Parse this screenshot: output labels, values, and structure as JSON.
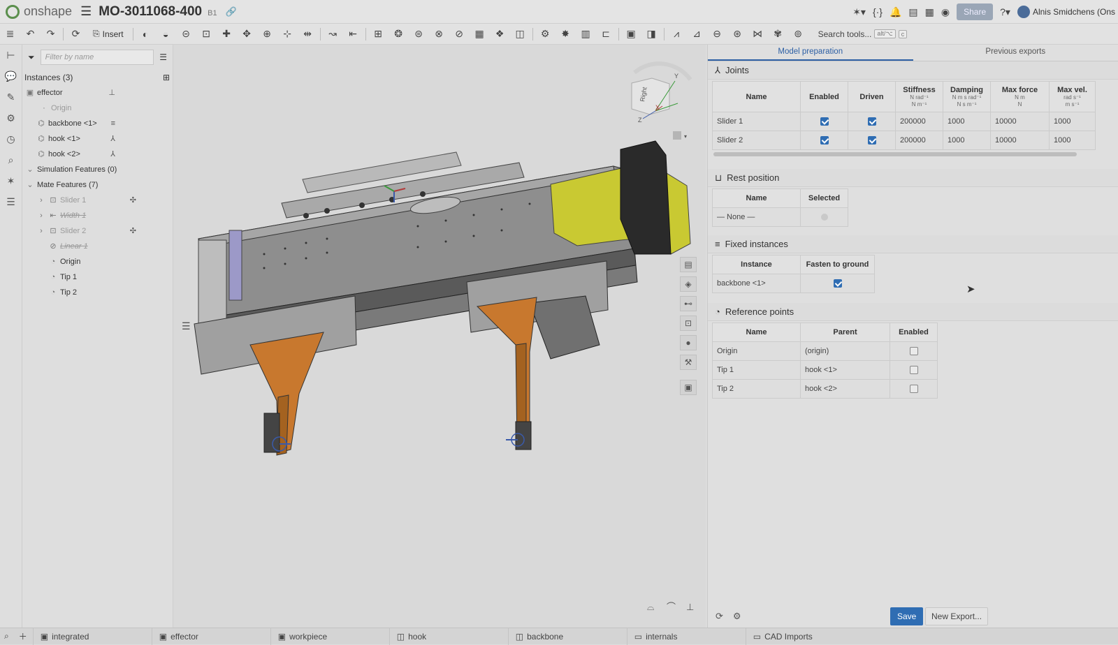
{
  "app": {
    "brand": "onshape",
    "doc_title": "MO-3011068-400",
    "doc_version": "B1"
  },
  "header": {
    "share_label": "Share",
    "user_name": "Alnis Smidchens (Ons"
  },
  "toolbar": {
    "insert_label": "Insert",
    "search_label": "Search tools...",
    "search_shortcut_1": "alt/⌥",
    "search_shortcut_2": "c"
  },
  "instances": {
    "filter_placeholder": "Filter by name",
    "header": "Instances (3)",
    "items": [
      {
        "label": "effector",
        "icon": "assembly-icon"
      },
      {
        "label": "Origin",
        "icon": "origin-icon"
      },
      {
        "label": "backbone <1>",
        "icon": "part-icon"
      },
      {
        "label": "hook <1>",
        "icon": "part-icon"
      },
      {
        "label": "hook <2>",
        "icon": "part-icon"
      },
      {
        "label": "Simulation Features (0)"
      },
      {
        "label": "Mate Features (7)"
      },
      {
        "label": "Slider 1"
      },
      {
        "label": "Width 1"
      },
      {
        "label": "Slider 2"
      },
      {
        "label": "Linear 1"
      },
      {
        "label": "Origin"
      },
      {
        "label": "Tip 1"
      },
      {
        "label": "Tip 2"
      }
    ]
  },
  "right_panel": {
    "tabs": [
      {
        "label": "Model preparation"
      },
      {
        "label": "Previous exports"
      }
    ],
    "joints": {
      "title": "Joints",
      "headers": {
        "name": "Name",
        "enabled": "Enabled",
        "driven": "Driven",
        "stiffness": "Stiffness",
        "stiffness_u1": "N rad⁻¹",
        "stiffness_u2": "N m⁻¹",
        "damping": "Damping",
        "damping_u1": "N m s rad⁻¹",
        "damping_u2": "N s m⁻¹",
        "max_force": "Max force",
        "max_force_u1": "N m",
        "max_force_u2": "N",
        "max_vel": "Max vel.",
        "max_vel_u1": "rad s⁻¹",
        "max_vel_u2": "m s⁻¹"
      },
      "rows": [
        {
          "name": "Slider 1",
          "enabled": true,
          "driven": true,
          "stiffness": "200000",
          "damping": "1000",
          "max_force": "10000",
          "max_vel": "1000"
        },
        {
          "name": "Slider 2",
          "enabled": true,
          "driven": true,
          "stiffness": "200000",
          "damping": "1000",
          "max_force": "10000",
          "max_vel": "1000"
        }
      ]
    },
    "rest_position": {
      "title": "Rest position",
      "headers": {
        "name": "Name",
        "selected": "Selected"
      },
      "rows": [
        {
          "name": "— None —"
        }
      ]
    },
    "fixed_instances": {
      "title": "Fixed instances",
      "headers": {
        "instance": "Instance",
        "fasten": "Fasten to ground"
      },
      "rows": [
        {
          "instance": "backbone <1>",
          "fasten": true
        }
      ]
    },
    "reference_points": {
      "title": "Reference points",
      "headers": {
        "name": "Name",
        "parent": "Parent",
        "enabled": "Enabled"
      },
      "rows": [
        {
          "name": "Origin",
          "parent": "(origin)",
          "enabled": false
        },
        {
          "name": "Tip 1",
          "parent": "hook <1>",
          "enabled": false
        },
        {
          "name": "Tip 2",
          "parent": "hook <2>",
          "enabled": false
        }
      ]
    },
    "save_label": "Save",
    "new_export_label": "New Export..."
  },
  "viewcube": {
    "face": "Right",
    "axis_x": "X",
    "axis_y": "Y",
    "axis_z": "Z"
  },
  "bottom_tabs": [
    {
      "label": "integrated"
    },
    {
      "label": "effector"
    },
    {
      "label": "workpiece"
    },
    {
      "label": "hook"
    },
    {
      "label": "backbone"
    },
    {
      "label": "internals"
    },
    {
      "label": "CAD Imports"
    }
  ],
  "colors": {
    "accent": "#2f6db3",
    "part_gray": "#8f8f8f",
    "part_orange": "#c8782e",
    "part_yellow": "#c9c932"
  }
}
